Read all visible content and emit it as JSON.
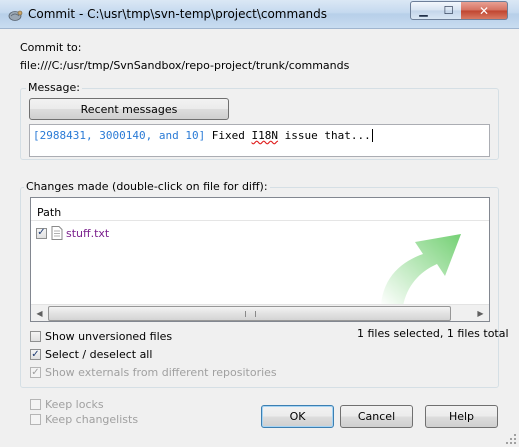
{
  "window": {
    "title": "Commit - C:\\usr\\tmp\\svn-temp\\project\\commands",
    "minimize_icon": "minimize-icon",
    "maximize_icon": "maximize-icon",
    "close_icon": "close-icon",
    "min_glyph": "▁",
    "max_glyph": "☐",
    "close_glyph": "✕"
  },
  "commit_to": {
    "label": "Commit to:",
    "url": "file:///C:/usr/tmp/SvnSandbox/repo-project/trunk/commands"
  },
  "message": {
    "legend": "Message:",
    "recent_button": "Recent messages",
    "text_blue": "[2988431, 3000140, and 10]",
    "text_plain1": " Fixed ",
    "text_spell": "I18N",
    "text_plain2": " issue that..."
  },
  "changes": {
    "legend": "Changes made (double-click on file for diff):",
    "column_path": "Path",
    "files": [
      {
        "name": "stuff.txt",
        "checked": true
      }
    ],
    "status": "1 files selected, 1 files total"
  },
  "options": {
    "show_unversioned": "Show unversioned files",
    "select_all": "Select / deselect all",
    "show_externals": "Show externals from different repositories",
    "keep_locks": "Keep locks",
    "keep_changelists": "Keep changelists"
  },
  "buttons": {
    "ok": "OK",
    "cancel": "Cancel",
    "help": "Help"
  },
  "colors": {
    "accent_blue": "#2b7bd6",
    "file_purple": "#7a1f8c",
    "watermark_green": "#5cc85c"
  }
}
